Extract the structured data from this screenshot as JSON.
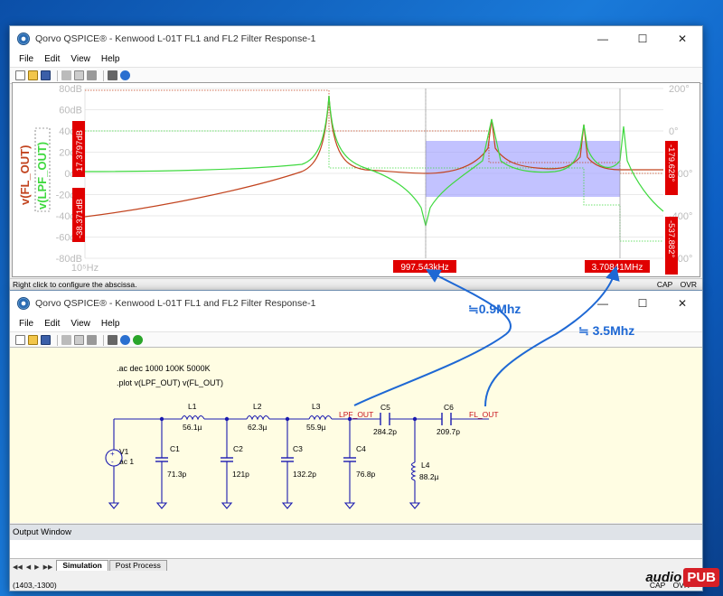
{
  "window1": {
    "title": "Qorvo QSPICE® - Kenwood L-01T FL1 and FL2 Filter Response-1",
    "menu": [
      "File",
      "Edit",
      "View",
      "Help"
    ],
    "plot": {
      "y_ticks_left": [
        "80dB",
        "60dB",
        "40dB",
        "20dB",
        "0dB",
        "-20dB",
        "-40dB",
        "-60dB",
        "-80dB"
      ],
      "y_ticks_right": [
        "200°",
        "0°",
        "-200°",
        "-400°",
        "-600°"
      ],
      "x_start_label": "10⁵Hz",
      "trace_labels": [
        "v(FL_OUT)",
        "v(LPF_OUT)"
      ],
      "cursor_left_value_1": "17.3797dB",
      "cursor_left_value_2": "-38.371dB",
      "cursor_right_value_1": "-179.628°",
      "cursor_right_value_2": "-537.882°",
      "cursor_x1": "997.543kHz",
      "cursor_x2": "3.70841MHz",
      "colors": {
        "fl_out": "#c2441f",
        "lpf_out": "#3fd93f",
        "cursor_label_bg": "#e00000",
        "selection": "#9999ff"
      }
    },
    "status_text": "Right click to configure the abscissa.",
    "status_indicators": [
      "CAP",
      "OVR"
    ]
  },
  "window2": {
    "title": "Qorvo QSPICE® - Kenwood L-01T FL1 and FL2 Filter Response-1",
    "menu": [
      "File",
      "Edit",
      "View",
      "Help"
    ],
    "directives": [
      ".ac dec 1000 100K 5000K",
      ".plot v(LPF_OUT) v(FL_OUT)"
    ],
    "components": {
      "V1": {
        "name": "V1",
        "value": "ac 1"
      },
      "L1": {
        "name": "L1",
        "value": "56.1µ"
      },
      "L2": {
        "name": "L2",
        "value": "62.3µ"
      },
      "L3": {
        "name": "L3",
        "value": "55.9µ"
      },
      "C1": {
        "name": "C1",
        "value": "71.3p"
      },
      "C2": {
        "name": "C2",
        "value": "121p"
      },
      "C3": {
        "name": "C3",
        "value": "132.2p"
      },
      "C4": {
        "name": "C4",
        "value": "76.8p"
      },
      "C5": {
        "name": "C5",
        "value": "284.2p"
      },
      "C6": {
        "name": "C6",
        "value": "209.7p"
      },
      "L4": {
        "name": "L4",
        "value": "88.2µ"
      }
    },
    "net_labels": [
      "LPF_OUT",
      "FL_OUT"
    ],
    "output_window_title": "Output Window",
    "tabs": [
      "Simulation",
      "Post Process"
    ],
    "coordinates": "(1403,-1300)",
    "status_indicators": [
      "CAP",
      "OVR"
    ]
  },
  "annotations": {
    "freq1": "≒0.9Mhz",
    "freq2": "≒ 3.5Mhz"
  },
  "logo": {
    "text1": "audio",
    "text2": "PUB"
  }
}
